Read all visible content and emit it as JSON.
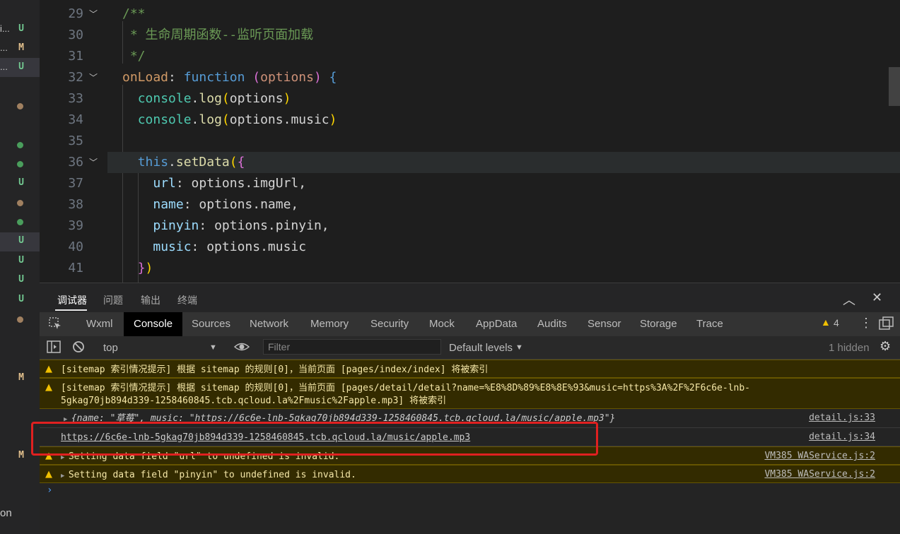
{
  "sidebar": {
    "fragments": [
      {
        "text": "i...",
        "badge": "U",
        "badge_color": "#73c991",
        "selected": false
      },
      {
        "text": "...",
        "badge": "M",
        "badge_color": "#e2c08d",
        "selected": false
      },
      {
        "text": "...",
        "badge": "U",
        "badge_color": "#73c991",
        "selected": true
      }
    ],
    "status_marks": [
      {
        "type": "dot",
        "color": "#a08060"
      },
      {
        "type": "dot",
        "color": "#4a9e5c"
      },
      {
        "type": "dot",
        "color": "#4a9e5c"
      },
      {
        "type": "badge",
        "text": "U",
        "color": "#73c991"
      },
      {
        "type": "dot",
        "color": "#a08060"
      },
      {
        "type": "dot",
        "color": "#4a9e5c"
      },
      {
        "type": "badge",
        "text": "U",
        "color": "#73c991",
        "selected": true
      },
      {
        "type": "badge",
        "text": "U",
        "color": "#73c991"
      },
      {
        "type": "badge",
        "text": "U",
        "color": "#73c991"
      },
      {
        "type": "badge",
        "text": "U",
        "color": "#73c991"
      },
      {
        "type": "dot",
        "color": "#a08060"
      }
    ],
    "m_badges": [
      "M",
      "M"
    ],
    "bottom_text": "on"
  },
  "editor": {
    "lines": [
      {
        "num": "29",
        "fold": true,
        "tokens": [
          [
            "c-cm",
            "/**"
          ]
        ]
      },
      {
        "num": "30",
        "tokens": [
          [
            "c-cm",
            " * 生命周期函数--监听页面加载"
          ]
        ]
      },
      {
        "num": "31",
        "tokens": [
          [
            "c-cm",
            " */"
          ]
        ]
      },
      {
        "num": "32",
        "fold": true,
        "tokens": [
          [
            "c-key",
            "onLoad"
          ],
          [
            "",
            ": "
          ],
          [
            "c-kw",
            "function"
          ],
          [
            "",
            " "
          ],
          [
            "c-br",
            "("
          ],
          [
            "c-par",
            "options"
          ],
          [
            "c-br",
            ")"
          ],
          [
            "",
            " "
          ],
          [
            "c-kw",
            "{"
          ]
        ]
      },
      {
        "num": "33",
        "tokens": [
          [
            "",
            "  "
          ],
          [
            "c-obj",
            "console"
          ],
          [
            "",
            "."
          ],
          [
            "c-fn",
            "log"
          ],
          [
            "c-br2",
            "("
          ],
          [
            "",
            "options"
          ],
          [
            "c-br2",
            ")"
          ]
        ]
      },
      {
        "num": "34",
        "tokens": [
          [
            "",
            "  "
          ],
          [
            "c-obj",
            "console"
          ],
          [
            "",
            "."
          ],
          [
            "c-fn",
            "log"
          ],
          [
            "c-br2",
            "("
          ],
          [
            "",
            "options.music"
          ],
          [
            "c-br2",
            ")"
          ]
        ]
      },
      {
        "num": "35",
        "tokens": [
          [
            "",
            ""
          ]
        ]
      },
      {
        "num": "36",
        "fold": true,
        "hl": true,
        "tokens": [
          [
            "",
            "  "
          ],
          [
            "c-this",
            "this"
          ],
          [
            "",
            "."
          ],
          [
            "c-meth",
            "setData"
          ],
          [
            "c-br2",
            "("
          ],
          [
            "c-br",
            "{"
          ]
        ]
      },
      {
        "num": "37",
        "tokens": [
          [
            "",
            "    "
          ],
          [
            "c-prop",
            "url"
          ],
          [
            "",
            ": options.imgUrl,"
          ]
        ]
      },
      {
        "num": "38",
        "tokens": [
          [
            "",
            "    "
          ],
          [
            "c-prop",
            "name"
          ],
          [
            "",
            ": options.name,"
          ]
        ]
      },
      {
        "num": "39",
        "tokens": [
          [
            "",
            "    "
          ],
          [
            "c-prop",
            "pinyin"
          ],
          [
            "",
            ": options.pinyin,"
          ]
        ]
      },
      {
        "num": "40",
        "tokens": [
          [
            "",
            "    "
          ],
          [
            "c-prop",
            "music"
          ],
          [
            "",
            ": options.music"
          ]
        ]
      },
      {
        "num": "41",
        "tokens": [
          [
            "",
            "  "
          ],
          [
            "c-br",
            "}"
          ],
          [
            "c-br2",
            ")"
          ]
        ]
      }
    ]
  },
  "panel_tabs": [
    {
      "label": "调试器",
      "active": true
    },
    {
      "label": "问题",
      "active": false
    },
    {
      "label": "输出",
      "active": false
    },
    {
      "label": "终端",
      "active": false
    }
  ],
  "devtools_tabs": [
    {
      "label": "Wxml",
      "active": false
    },
    {
      "label": "Console",
      "active": true
    },
    {
      "label": "Sources",
      "active": false
    },
    {
      "label": "Network",
      "active": false
    },
    {
      "label": "Memory",
      "active": false
    },
    {
      "label": "Security",
      "active": false
    },
    {
      "label": "Mock",
      "active": false
    },
    {
      "label": "AppData",
      "active": false
    },
    {
      "label": "Audits",
      "active": false
    },
    {
      "label": "Sensor",
      "active": false
    },
    {
      "label": "Storage",
      "active": false
    },
    {
      "label": "Trace",
      "active": false
    }
  ],
  "warning_count": "4",
  "toolbar": {
    "context": "top",
    "filter_placeholder": "Filter",
    "levels": "Default levels",
    "hidden": "1 hidden"
  },
  "console": {
    "messages": [
      {
        "level": "warn",
        "text": "[sitemap 索引情况提示] 根据 sitemap 的规则[0]，当前页面 [pages/index/index] 将被索引",
        "source": ""
      },
      {
        "level": "warn",
        "text": "[sitemap 索引情况提示] 根据 sitemap 的规则[0]，当前页面 [pages/detail/detail?name=%E8%8D%89%E8%8E%93&music=https%3A%2F%2F6c6e-lnb-\n5gkag70jb894d339-1258460845.tcb.qcloud.la%2Fmusic%2Fapple.mp3] 将被索引",
        "source": ""
      },
      {
        "level": "log",
        "text": "{name: \"草莓\", music: \"https://6c6e-lnb-5gkag70jb894d339-1258460845.tcb.qcloud.la/music/apple.mp3\"}",
        "source": "detail.js:33"
      },
      {
        "level": "log",
        "text": "https://6c6e-lnb-5gkag70jb894d339-1258460845.tcb.qcloud.la/music/apple.mp3",
        "source": "detail.js:34"
      },
      {
        "level": "warn",
        "text": "Setting data field \"url\" to undefined is invalid.",
        "source": "VM385 WAService.js:2"
      },
      {
        "level": "warn",
        "text": "Setting data field \"pinyin\" to undefined is invalid.",
        "source": "VM385 WAService.js:2"
      }
    ],
    "prompt": "›"
  },
  "colors": {
    "accent_red_box": "#e02020",
    "warn_bg": "#332b00",
    "warn_icon": "#f0c000"
  }
}
